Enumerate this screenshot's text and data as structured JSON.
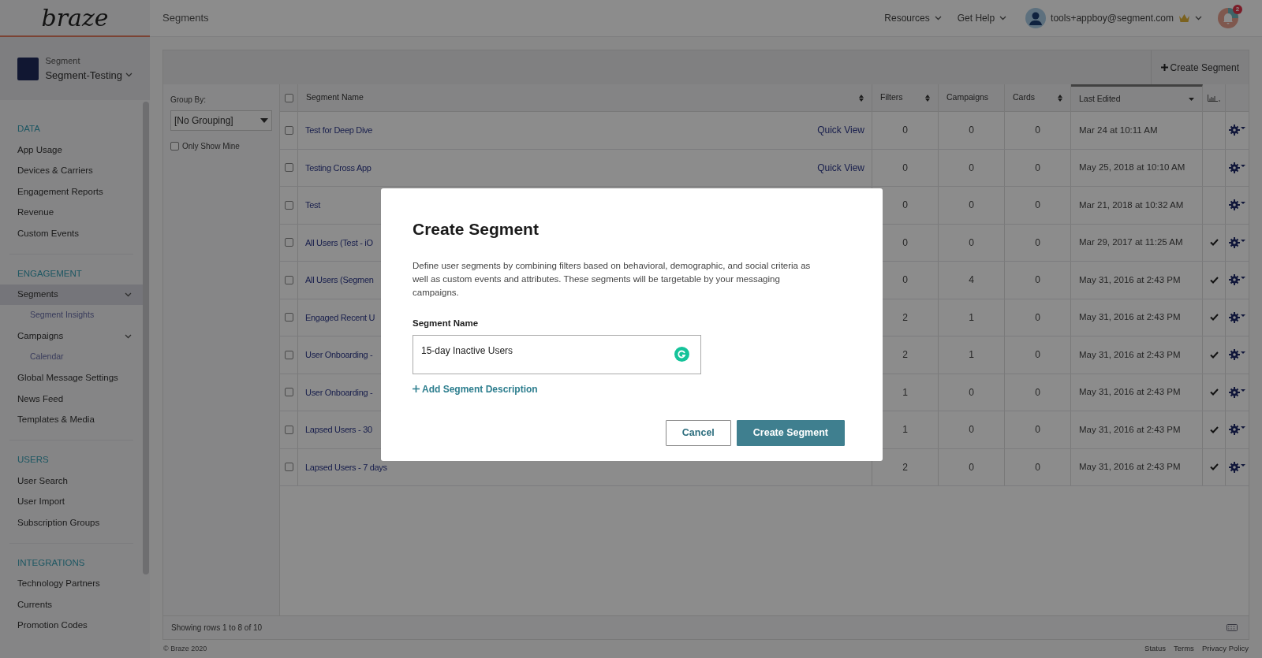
{
  "sidebar": {
    "logo": "braze",
    "account": {
      "label": "Segment",
      "name": "Segment-Testing"
    },
    "sections": [
      {
        "title": "DATA",
        "items": [
          {
            "label": "App Usage",
            "selected": false
          },
          {
            "label": "Devices & Carriers",
            "selected": false
          },
          {
            "label": "Engagement Reports",
            "selected": false
          },
          {
            "label": "Revenue",
            "selected": false
          },
          {
            "label": "Custom Events",
            "selected": false
          }
        ]
      },
      {
        "title": "ENGAGEMENT",
        "items": [
          {
            "label": "Segments",
            "selected": true,
            "children": [
              {
                "label": "Segment Insights",
                "selected": false
              }
            ]
          },
          {
            "label": "Campaigns",
            "selected": false,
            "children": [
              {
                "label": "Calendar",
                "selected": false
              }
            ]
          },
          {
            "label": "Global Message Settings",
            "selected": false
          },
          {
            "label": "News Feed",
            "selected": false
          },
          {
            "label": "Templates & Media",
            "selected": false
          }
        ]
      },
      {
        "title": "USERS",
        "items": [
          {
            "label": "User Search",
            "selected": false
          },
          {
            "label": "User Import",
            "selected": false
          },
          {
            "label": "Subscription Groups",
            "selected": false
          }
        ]
      },
      {
        "title": "INTEGRATIONS",
        "items": [
          {
            "label": "Technology Partners",
            "selected": false
          },
          {
            "label": "Currents",
            "selected": false
          },
          {
            "label": "Promotion Codes",
            "selected": false
          }
        ]
      }
    ]
  },
  "topbar": {
    "page_title": "Segments",
    "menus": [
      "Resources",
      "Get Help"
    ],
    "user_email": "tools+appboy@segment.com",
    "notification_count": "2"
  },
  "toolbar": {
    "create_button": "Create Segment"
  },
  "filters": {
    "group_by_label": "Group By:",
    "group_by_value": "[No Grouping]",
    "only_show_mine": {
      "label": "Only Show Mine",
      "checked": false
    }
  },
  "table": {
    "select_all_checked": false,
    "columns": [
      {
        "label": "Segment Name",
        "sortable": true,
        "sorted": false
      },
      {
        "label": "Filters",
        "sortable": true,
        "sorted": false
      },
      {
        "label": "Campaigns",
        "sortable": false,
        "sorted": false
      },
      {
        "label": "Cards",
        "sortable": true,
        "sorted": false
      },
      {
        "label": "Last Edited",
        "sortable": true,
        "sorted": true
      }
    ],
    "rows": [
      {
        "selected": false,
        "name": "Test for Deep Dive",
        "quick_view": "Quick View",
        "filters": "0",
        "campaigns": "0",
        "cards": "0",
        "last_edited": "Mar 24 at 10:11 AM",
        "checked": false
      },
      {
        "selected": false,
        "name": "Testing Cross App",
        "quick_view": "Quick View",
        "filters": "0",
        "campaigns": "0",
        "cards": "0",
        "last_edited": "May 25, 2018 at 10:10 AM",
        "checked": false
      },
      {
        "selected": false,
        "name": "Test",
        "filters": "0",
        "campaigns": "0",
        "cards": "0",
        "last_edited": "Mar 21, 2018 at 10:32 AM",
        "checked": false
      },
      {
        "selected": false,
        "name": "All Users (Test - iO",
        "filters": "0",
        "campaigns": "0",
        "cards": "0",
        "last_edited": "Mar 29, 2017 at 11:25 AM",
        "checked": true
      },
      {
        "selected": false,
        "name": "All Users (Segmen",
        "filters": "0",
        "campaigns": "4",
        "cards": "0",
        "last_edited": "May 31, 2016 at 2:43 PM",
        "checked": true
      },
      {
        "selected": false,
        "name": "Engaged Recent U",
        "filters": "2",
        "campaigns": "1",
        "cards": "0",
        "last_edited": "May 31, 2016 at 2:43 PM",
        "checked": true
      },
      {
        "selected": false,
        "name": "User Onboarding -",
        "filters": "2",
        "campaigns": "1",
        "cards": "0",
        "last_edited": "May 31, 2016 at 2:43 PM",
        "checked": true
      },
      {
        "selected": false,
        "name": "User Onboarding -",
        "filters": "1",
        "campaigns": "0",
        "cards": "0",
        "last_edited": "May 31, 2016 at 2:43 PM",
        "checked": true
      },
      {
        "selected": false,
        "name": "Lapsed Users - 30",
        "filters": "1",
        "campaigns": "0",
        "cards": "0",
        "last_edited": "May 31, 2016 at 2:43 PM",
        "checked": true
      },
      {
        "selected": false,
        "name": "Lapsed Users - 7 days",
        "filters": "2",
        "campaigns": "0",
        "cards": "0",
        "last_edited": "May 31, 2016 at 2:43 PM",
        "checked": true
      }
    ],
    "footer": "Showing rows 1 to 8 of 10"
  },
  "page_footer": {
    "copyright": "© Braze 2020",
    "links": [
      "Status",
      "Terms",
      "Privacy Policy"
    ]
  },
  "modal": {
    "title": "Create Segment",
    "description": "Define user segments by combining filters based on behavioral, demographic, and social criteria as well as custom events and attributes. These segments will be targetable by your messaging campaigns.",
    "field_label": "Segment Name",
    "field_value": "15-day Inactive Users",
    "add_link": "Add Segment Description",
    "buttons": [
      {
        "label": "Cancel",
        "kind": "secondary"
      },
      {
        "label": "Create Segment",
        "kind": "primary"
      }
    ]
  }
}
